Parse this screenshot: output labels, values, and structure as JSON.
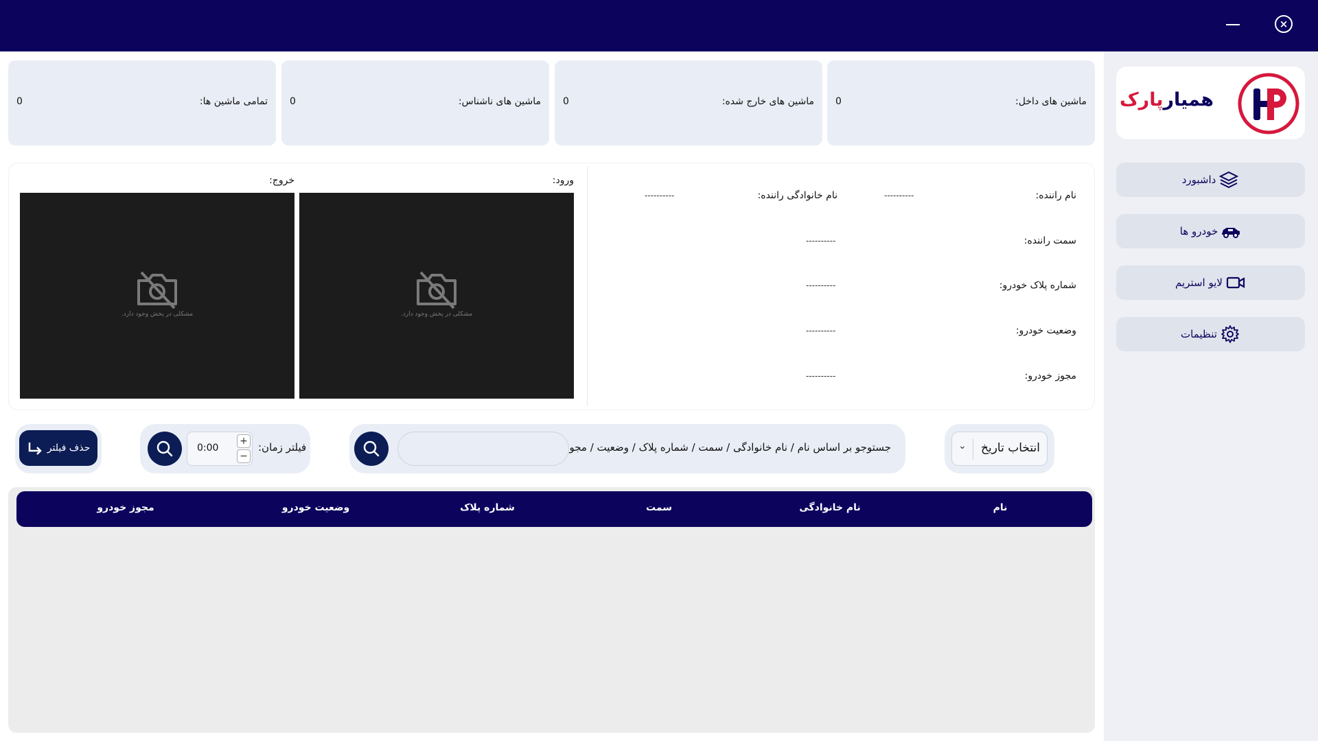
{
  "window": {
    "close_symbol": "×"
  },
  "brand": {
    "name_part1": "همیار",
    "name_part2": "پارک",
    "colors": {
      "primary": "#0c035d",
      "accent": "#d6183c"
    }
  },
  "sidebar": {
    "items": [
      {
        "label": "داشبورد",
        "icon": "layers-icon"
      },
      {
        "label": "خودرو ها",
        "icon": "car-icon"
      },
      {
        "label": "لایو استریم",
        "icon": "video-camera-icon"
      },
      {
        "label": "تنظیمات",
        "icon": "gear-icon"
      }
    ]
  },
  "stats": [
    {
      "label": "ماشین های داخل:",
      "value": "0"
    },
    {
      "label": "ماشین های خارج شده:",
      "value": "0"
    },
    {
      "label": "ماشین های ناشناس:",
      "value": "0"
    },
    {
      "label": "تمامی ماشین ها:",
      "value": "0"
    }
  ],
  "driver": {
    "name_label": "نام راننده:",
    "name_value": "----------",
    "family_label": "نام خانوادگی راننده:",
    "family_value": "----------",
    "position_label": "سمت راننده:",
    "position_value": "----------",
    "plate_label": "شماره پلاک خودرو:",
    "plate_value": "----------",
    "status_label": "وضعیت خودرو:",
    "status_value": "----------",
    "permit_label": "مجوز خودرو:",
    "permit_value": "----------"
  },
  "cameras": {
    "entry_label": "ورود:",
    "exit_label": "خروج:",
    "error_message": "مشکلی در پخش وجود دارد."
  },
  "filters": {
    "date_select": "انتخاب تاریخ",
    "search_label": "جستوجو بر اساس نام / نام خانوادگی / سمت / شماره پلاک / وضعیت / مجوز :",
    "search_value": "",
    "time_label": "فیلتر زمان:",
    "time_value": "0:00",
    "plus": "+",
    "minus": "−",
    "clear_label": "حذف فیلتر"
  },
  "table": {
    "columns": [
      "نام",
      "نام خانوادگی",
      "سمت",
      "شماره پلاک",
      "وضعیت خودرو",
      "مجوز خودرو"
    ],
    "rows": []
  }
}
